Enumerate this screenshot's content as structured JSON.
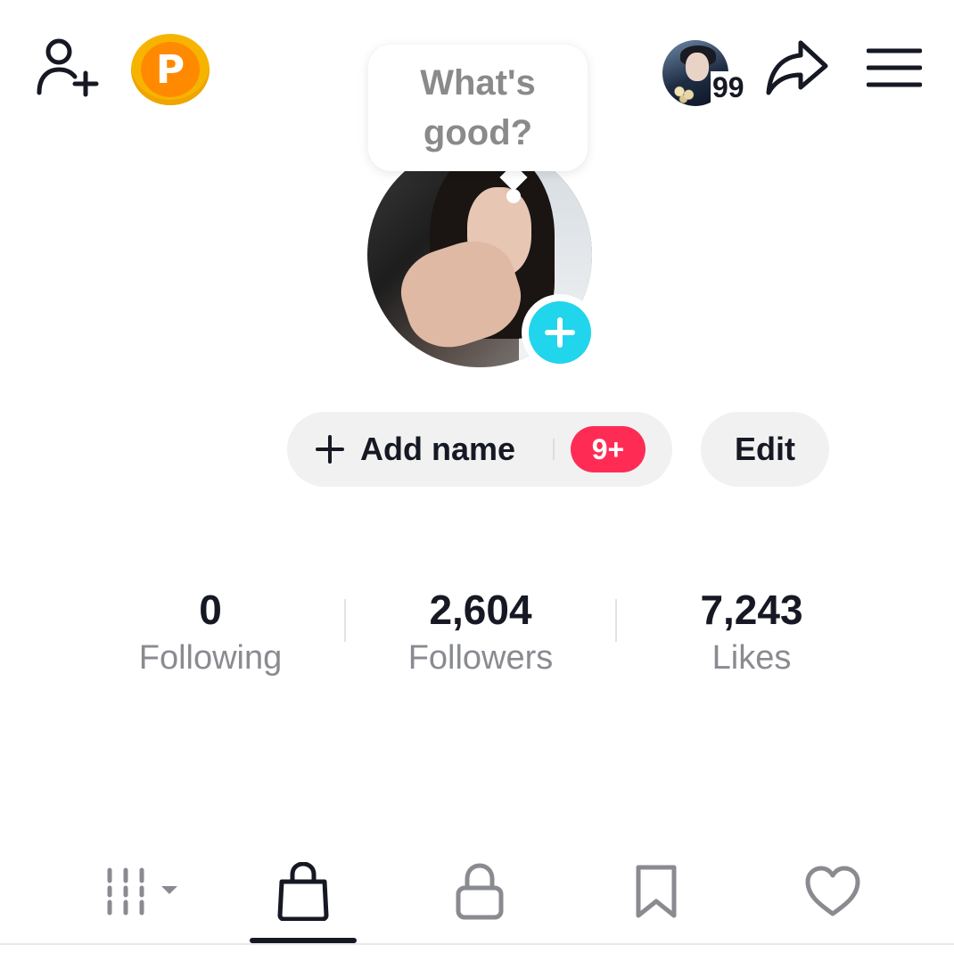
{
  "header": {
    "coin_letter": "P",
    "notification_count": "99"
  },
  "bubble": {
    "text_line1": "What's",
    "text_line2": "good?"
  },
  "profile": {
    "add_name_label": "Add name",
    "badge": "9+",
    "edit_label": "Edit"
  },
  "stats": [
    {
      "value": "0",
      "label": "Following"
    },
    {
      "value": "2,604",
      "label": "Followers"
    },
    {
      "value": "7,243",
      "label": "Likes"
    }
  ],
  "tabs": [
    {
      "icon": "grid-icon",
      "selected": false
    },
    {
      "icon": "shopping-bag-icon",
      "selected": true
    },
    {
      "icon": "lock-icon",
      "selected": false
    },
    {
      "icon": "bookmark-icon",
      "selected": false
    },
    {
      "icon": "heart-icon",
      "selected": false
    }
  ],
  "colors": {
    "accent_badge": "#fe2c55",
    "add_photo": "#20d5ec",
    "coin": "#f6b400",
    "text_primary": "#161823",
    "text_secondary": "#8a8b91"
  }
}
